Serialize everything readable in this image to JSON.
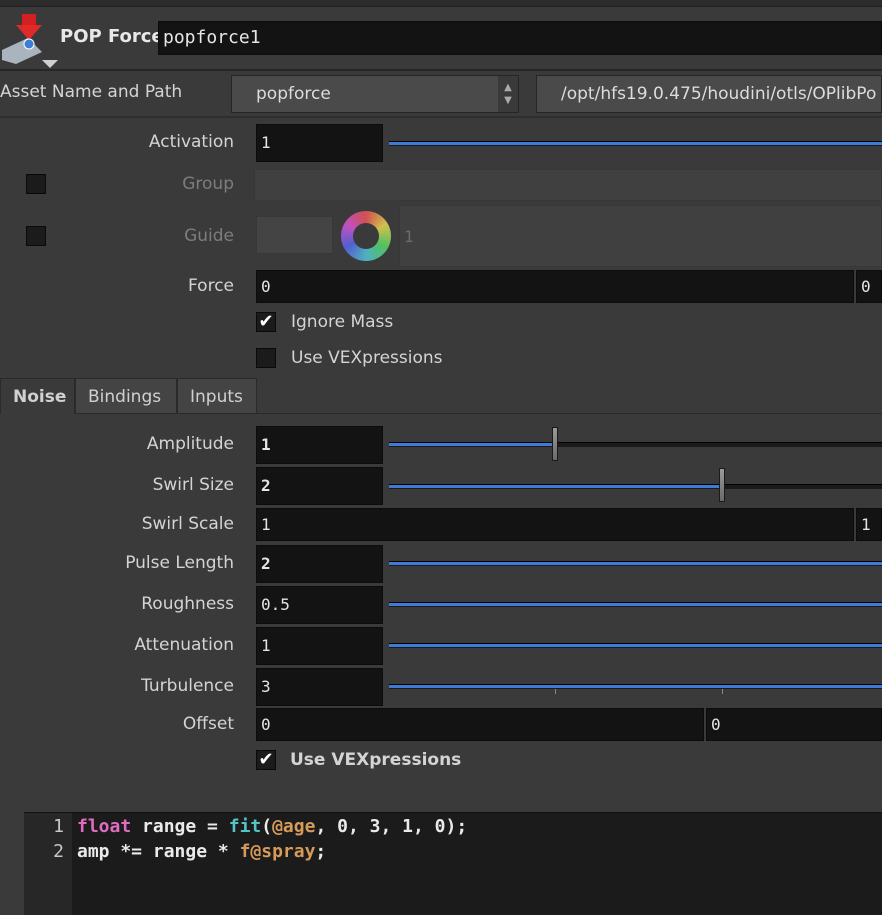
{
  "header": {
    "node_type": "POP Force",
    "node_name": "popforce1"
  },
  "asset": {
    "label": "Asset Name and Path",
    "name": "popforce",
    "path": "/opt/hfs19.0.475/houdini/otls/OPlibPo"
  },
  "params": {
    "activation": {
      "label": "Activation",
      "value": "1"
    },
    "group": {
      "label": "Group",
      "value": ""
    },
    "guide": {
      "label": "Guide",
      "value": "1"
    },
    "force": {
      "label": "Force",
      "x": "0",
      "y": "0"
    },
    "ignore_mass": {
      "label": "Ignore Mass",
      "checked": true
    },
    "use_vex_top": {
      "label": "Use VEXpressions",
      "checked": false
    }
  },
  "tabs": [
    {
      "label": "Noise",
      "active": true
    },
    {
      "label": "Bindings",
      "active": false
    },
    {
      "label": "Inputs",
      "active": false
    }
  ],
  "noise": {
    "amplitude": {
      "label": "Amplitude",
      "value": "1",
      "level": 0.33
    },
    "swirl_size": {
      "label": "Swirl Size",
      "value": "2",
      "level": 0.67
    },
    "swirl_scale": {
      "label": "Swirl Scale",
      "x": "1",
      "y": "1"
    },
    "pulse_length": {
      "label": "Pulse Length",
      "value": "2"
    },
    "roughness": {
      "label": "Roughness",
      "value": "0.5"
    },
    "attenuation": {
      "label": "Attenuation",
      "value": "1"
    },
    "turbulence": {
      "label": "Turbulence",
      "value": "3"
    },
    "offset": {
      "label": "Offset",
      "x": "0",
      "y": "0"
    },
    "use_vex": {
      "label": "Use VEXpressions",
      "checked": true
    }
  },
  "code": {
    "line_numbers": [
      "1",
      "2"
    ],
    "line1": {
      "kw": "float",
      "t1": " range = ",
      "fn": "fit",
      "t2": "(",
      "attr": "@age",
      "t3": ", 0, 3, 1, 0);"
    },
    "line2": {
      "t1": "amp *= range * ",
      "attr": "f@spray",
      "t2": ";"
    }
  },
  "colors": {
    "slider_fill": "#3f7bd6",
    "keyword": "#e06cc0",
    "function": "#52c4c4",
    "attribute": "#d69a5a"
  }
}
